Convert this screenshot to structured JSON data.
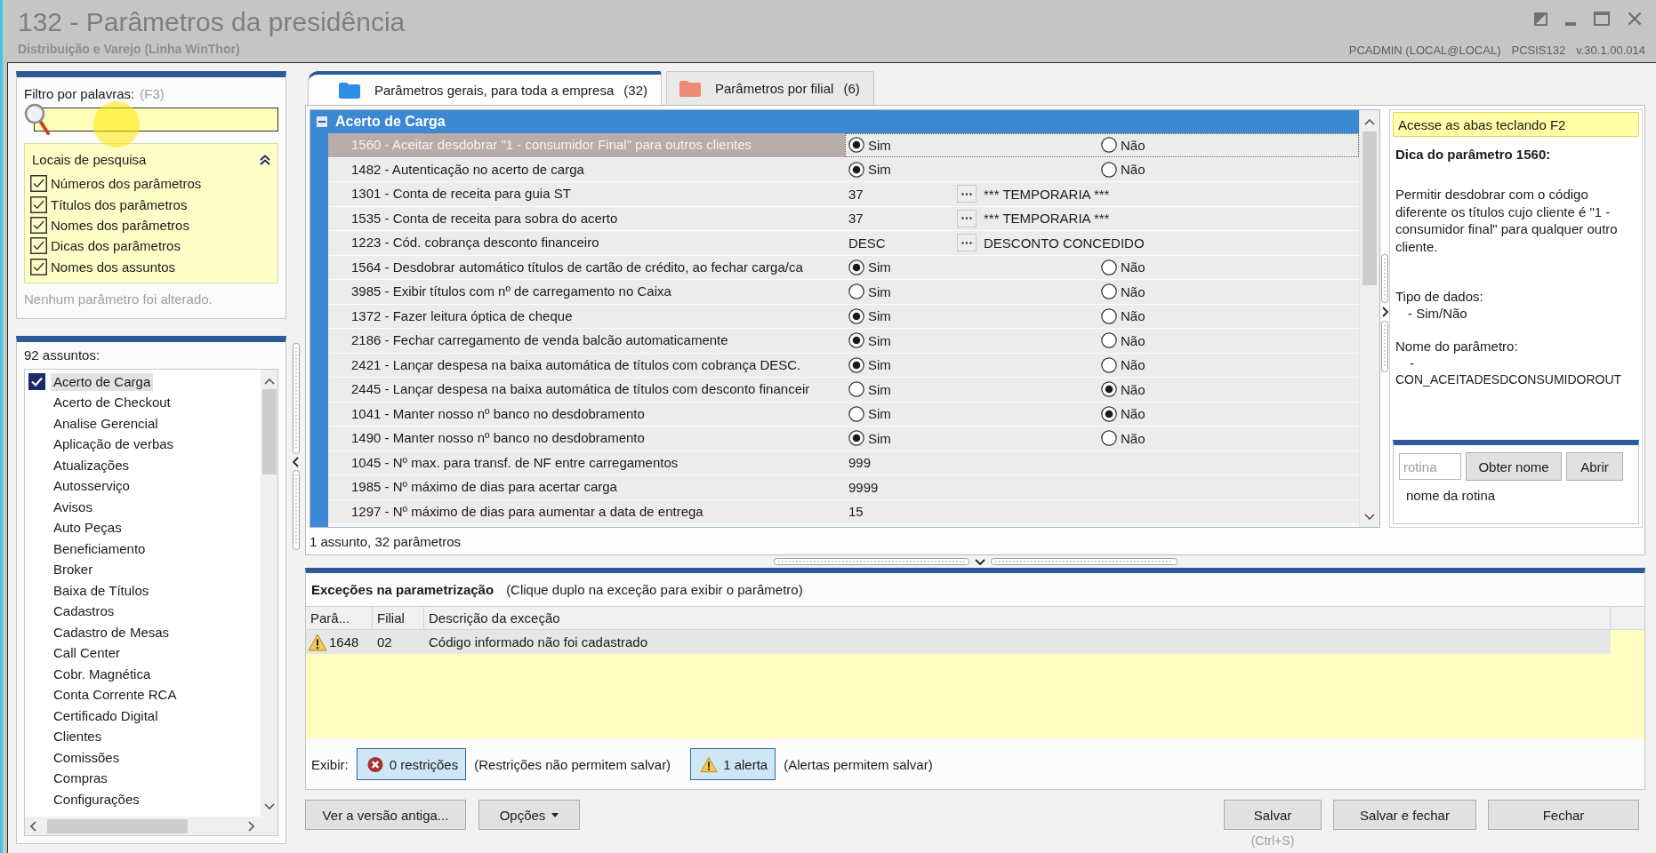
{
  "window": {
    "title": "132 - Parâmetros da presidência",
    "subtitle": "Distribuição e Varejo (Linha WinThor)",
    "user": "PCADMIN (LOCAL@LOCAL)",
    "routine": "PCSIS132",
    "version": "v.30.1.00.014"
  },
  "filter": {
    "label": "Filtro por palavras:",
    "shortcut": "(F3)"
  },
  "search_locations": {
    "title": "Locais de pesquisa",
    "expanded": true,
    "options": [
      {
        "label": "Números dos parâmetros",
        "checked": true
      },
      {
        "label": "Títulos dos parâmetros",
        "checked": true
      },
      {
        "label": "Nomes dos parâmetros",
        "checked": true
      },
      {
        "label": "Dicas dos parâmetros",
        "checked": true
      },
      {
        "label": "Nomes dos assuntos",
        "checked": true
      }
    ]
  },
  "change_status": "Nenhum parâmetro foi alterado.",
  "subjects": {
    "label": "92 assuntos:",
    "items": [
      {
        "label": "Acerto de Carga",
        "selected": true
      },
      {
        "label": "Acerto de Checkout",
        "selected": false
      },
      {
        "label": "Analise Gerencial",
        "selected": false
      },
      {
        "label": "Aplicação de verbas",
        "selected": false
      },
      {
        "label": "Atualizações",
        "selected": false
      },
      {
        "label": "Autosserviço",
        "selected": false
      },
      {
        "label": "Avisos",
        "selected": false
      },
      {
        "label": "Auto Peças",
        "selected": false
      },
      {
        "label": "Beneficiamento",
        "selected": false
      },
      {
        "label": "Broker",
        "selected": false
      },
      {
        "label": "Baixa de Títulos",
        "selected": false
      },
      {
        "label": "Cadastros",
        "selected": false
      },
      {
        "label": "Cadastro de Mesas",
        "selected": false
      },
      {
        "label": "Call Center",
        "selected": false
      },
      {
        "label": "Cobr. Magnética",
        "selected": false
      },
      {
        "label": "Conta Corrente RCA",
        "selected": false
      },
      {
        "label": "Certificado Digital",
        "selected": false
      },
      {
        "label": "Clientes",
        "selected": false
      },
      {
        "label": "Comissões",
        "selected": false
      },
      {
        "label": "Compras",
        "selected": false
      },
      {
        "label": "Configurações",
        "selected": false
      }
    ]
  },
  "tabs": [
    {
      "label": "Parâmetros gerais, para toda a empresa",
      "count": "(32)",
      "selected": true,
      "color": "#2f8fe6"
    },
    {
      "label": "Parâmetros por filial",
      "count": "(6)",
      "selected": false,
      "color": "#ee8a74"
    }
  ],
  "parameters": {
    "group": {
      "title": "Acerto de Carga",
      "expanded": true
    },
    "rows": [
      {
        "label": "1560 - Aceitar desdobrar \"1 - consumidor Final\" para outros clientes",
        "selected": true,
        "kind": "yesno",
        "options": [
          {
            "label": "Sim",
            "selected": true
          },
          {
            "label": "Não",
            "selected": false
          }
        ]
      },
      {
        "label": "1482 - Autenticação no acerto de carga",
        "selected": false,
        "kind": "yesno",
        "options": [
          {
            "label": "Sim",
            "selected": true
          },
          {
            "label": "Não",
            "selected": false
          }
        ]
      },
      {
        "label": "1301 - Conta de receita para guia ST",
        "selected": false,
        "kind": "lookup",
        "value": "37",
        "description": "*** TEMPORARIA ***"
      },
      {
        "label": "1535 - Conta de receita para sobra do acerto",
        "selected": false,
        "kind": "lookup",
        "value": "37",
        "description": "*** TEMPORARIA ***"
      },
      {
        "label": "1223 - Cód. cobrança desconto financeiro",
        "selected": false,
        "kind": "lookup",
        "value": "DESC",
        "description": "DESCONTO CONCEDIDO"
      },
      {
        "label": "1564 - Desdobrar automático títulos de cartão de crédito, ao fechar carga/ca",
        "selected": false,
        "kind": "yesno",
        "options": [
          {
            "label": "Sim",
            "selected": true
          },
          {
            "label": "Não",
            "selected": false
          }
        ]
      },
      {
        "label": "3985 - Exibir títulos com nº de carregamento no Caixa",
        "selected": false,
        "kind": "yesno",
        "options": [
          {
            "label": "Sim",
            "selected": false
          },
          {
            "label": "Não",
            "selected": false
          }
        ]
      },
      {
        "label": "1372 - Fazer leitura óptica de cheque",
        "selected": false,
        "kind": "yesno",
        "options": [
          {
            "label": "Sim",
            "selected": true
          },
          {
            "label": "Não",
            "selected": false
          }
        ]
      },
      {
        "label": "2186 - Fechar carregamento de venda balcão automaticamente",
        "selected": false,
        "kind": "yesno",
        "options": [
          {
            "label": "Sim",
            "selected": true
          },
          {
            "label": "Não",
            "selected": false
          }
        ]
      },
      {
        "label": "2421 - Lançar despesa na baixa automática de títulos com cobrança DESC.",
        "selected": false,
        "kind": "yesno",
        "options": [
          {
            "label": "Sim",
            "selected": true
          },
          {
            "label": "Não",
            "selected": false
          }
        ]
      },
      {
        "label": "2445 - Lançar despesa na baixa automática de títulos com desconto financeir",
        "selected": false,
        "kind": "yesno",
        "options": [
          {
            "label": "Sim",
            "selected": false
          },
          {
            "label": "Não",
            "selected": true
          }
        ]
      },
      {
        "label": "1041 - Manter nosso nº banco no desdobramento",
        "selected": false,
        "kind": "yesno",
        "options": [
          {
            "label": "Sim",
            "selected": false
          },
          {
            "label": "Não",
            "selected": true
          }
        ]
      },
      {
        "label": "1490 - Manter nosso nº banco no desdobramento",
        "selected": false,
        "kind": "yesno",
        "options": [
          {
            "label": "Sim",
            "selected": true
          },
          {
            "label": "Não",
            "selected": false
          }
        ]
      },
      {
        "label": "1045 - Nº max. para transf. de NF entre carregamentos",
        "selected": false,
        "kind": "number",
        "value": "999"
      },
      {
        "label": "1985 - Nº máximo de dias para acertar carga",
        "selected": false,
        "kind": "number",
        "value": "9999"
      },
      {
        "label": "1297 - Nº máximo de dias para aumentar a data de entrega",
        "selected": false,
        "kind": "number",
        "value": "15"
      }
    ],
    "summary": "1 assunto, 32 parâmetros"
  },
  "hint_panel": {
    "banner": "Acesse as abas teclando F2",
    "title": "Dica do parâmetro 1560:",
    "text": "Permitir desdobrar com o código diferente os títulos cujo cliente é \"1 - consumidor final\" para qualquer outro cliente.",
    "data_type_label": "Tipo de dados:",
    "data_type": "- Sim/Não",
    "name_label": "Nome do parâmetro:",
    "name_dash": "-",
    "name": "CON_ACEITADESDCONSUMIDOROUT"
  },
  "routine_lookup": {
    "placeholder": "rotina",
    "buttons": [
      "Obter nome",
      "Abrir"
    ],
    "result": "nome da rotina"
  },
  "exceptions": {
    "title": "Exceções na parametrização",
    "hint": "(Clique duplo na exceção para exibir o parâmetro)",
    "columns": [
      "Parâ...",
      "Filial",
      "Descrição da exceção"
    ],
    "rows": [
      {
        "kind": "alert",
        "cells": [
          "1648",
          "02",
          "Código informado não foi cadastrado"
        ]
      }
    ],
    "show_label": "Exibir:",
    "filters": [
      {
        "kind": "restriction",
        "label": "0 restrições",
        "on": true,
        "note": "(Restrições não permitem salvar)"
      },
      {
        "kind": "alert",
        "label": "1 alerta",
        "on": true,
        "note": "(Alertas permitem salvar)"
      }
    ]
  },
  "actions": {
    "left": [
      {
        "label": "Ver a versão antiga...",
        "kind": "button"
      },
      {
        "label": "Opções",
        "kind": "menu"
      }
    ],
    "right": [
      {
        "label": "Salvar",
        "shortcut": "(Ctrl+S)"
      },
      {
        "label": "Salvar e fechar"
      },
      {
        "label": "Fechar"
      }
    ]
  }
}
